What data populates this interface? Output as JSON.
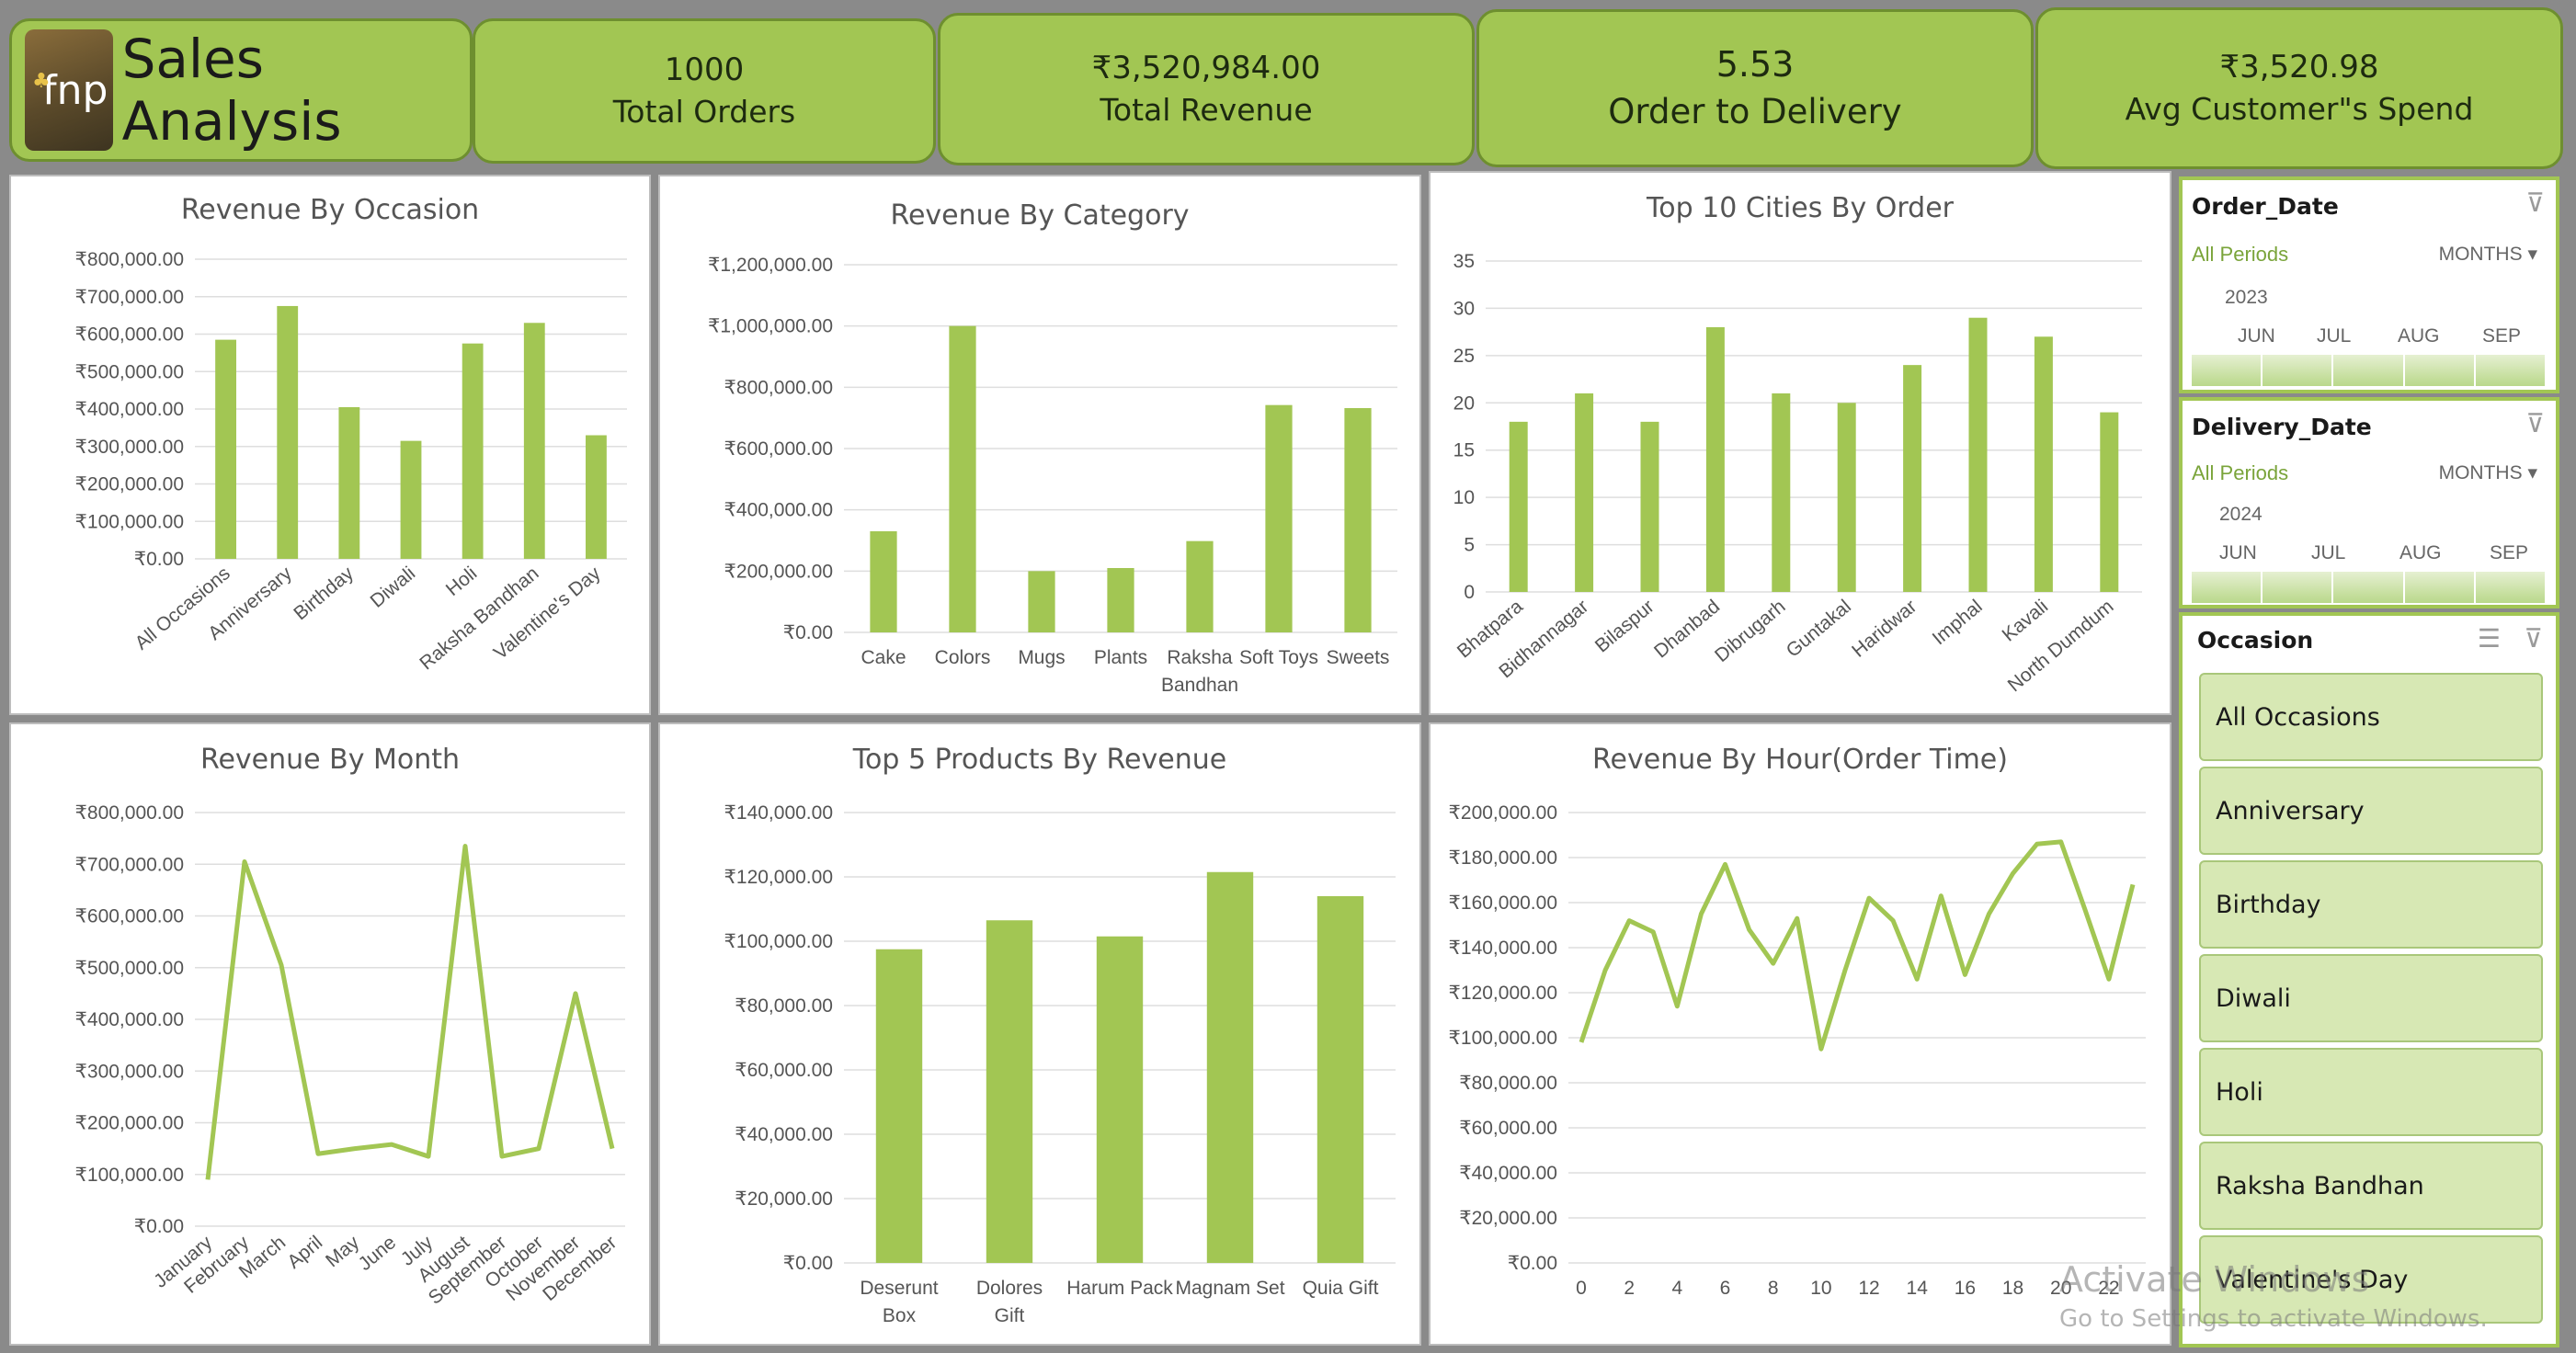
{
  "header": {
    "title": "Sales Analysis",
    "logo_text": "fnp",
    "kpis": [
      {
        "value": "1000",
        "label": "Total Orders"
      },
      {
        "value": "₹3,520,984.00",
        "label": "Total Revenue"
      },
      {
        "value": "5.53",
        "label": "Order to  Delivery"
      },
      {
        "value": "₹3,520.98",
        "label": "Avg Customer\"s Spend"
      }
    ]
  },
  "chart_data": [
    {
      "type": "bar",
      "title": "Revenue By Occasion",
      "categories": [
        "All Occasions",
        "Anniversary",
        "Birthday",
        "Diwali",
        "Holi",
        "Raksha Bandhan",
        "Valentine's Day"
      ],
      "values": [
        585000,
        675000,
        405000,
        315000,
        575000,
        630000,
        330000
      ],
      "ylim": [
        0,
        800000
      ],
      "yticks": [
        "₹0.00",
        "₹100,000.00",
        "₹200,000.00",
        "₹300,000.00",
        "₹400,000.00",
        "₹500,000.00",
        "₹600,000.00",
        "₹700,000.00",
        "₹800,000.00"
      ]
    },
    {
      "type": "bar",
      "title": "Revenue By Category",
      "categories": [
        "Cake",
        "Colors",
        "Mugs",
        "Plants",
        "Raksha Bandhan",
        "Soft Toys",
        "Sweets"
      ],
      "values": [
        330000,
        1000000,
        200000,
        210000,
        298000,
        742000,
        732000
      ],
      "ylim": [
        0,
        1200000
      ],
      "yticks": [
        "₹0.00",
        "₹200,000.00",
        "₹400,000.00",
        "₹600,000.00",
        "₹800,000.00",
        "₹1,000,000.00",
        "₹1,200,000.00"
      ]
    },
    {
      "type": "bar",
      "title": "Top 10 Cities By Order",
      "categories": [
        "Bhatpara",
        "Bidhannagar",
        "Bilaspur",
        "Dhanbad",
        "Dibrugarh",
        "Guntakal",
        "Haridwar",
        "Imphal",
        "Kavali",
        "North Dumdum"
      ],
      "values": [
        18,
        21,
        18,
        28,
        21,
        20,
        24,
        29,
        27,
        19
      ],
      "ylim": [
        0,
        35
      ],
      "yticks": [
        "0",
        "5",
        "10",
        "15",
        "20",
        "25",
        "30",
        "35"
      ]
    },
    {
      "type": "line",
      "title": "Revenue By Month",
      "categories": [
        "January",
        "February",
        "March",
        "April",
        "May",
        "June",
        "July",
        "August",
        "September",
        "October",
        "November",
        "December"
      ],
      "values": [
        90000,
        705000,
        505000,
        140000,
        150000,
        158000,
        135000,
        735000,
        135000,
        150000,
        450000,
        150000
      ],
      "ylim": [
        0,
        800000
      ],
      "yticks": [
        "₹0.00",
        "₹100,000.00",
        "₹200,000.00",
        "₹300,000.00",
        "₹400,000.00",
        "₹500,000.00",
        "₹600,000.00",
        "₹700,000.00",
        "₹800,000.00"
      ]
    },
    {
      "type": "bar",
      "title": "Top 5 Products By Revenue",
      "categories": [
        "Deserunt Box",
        "Dolores Gift",
        "Harum Pack",
        "Magnam Set",
        "Quia Gift"
      ],
      "values": [
        97500,
        106500,
        101500,
        121500,
        114000
      ],
      "ylim": [
        0,
        140000
      ],
      "yticks": [
        "₹0.00",
        "₹20,000.00",
        "₹40,000.00",
        "₹60,000.00",
        "₹80,000.00",
        "₹100,000.00",
        "₹120,000.00",
        "₹140,000.00"
      ]
    },
    {
      "type": "line",
      "title": "Revenue By Hour(Order Time)",
      "x": [
        0,
        1,
        2,
        3,
        4,
        5,
        6,
        7,
        8,
        9,
        10,
        11,
        12,
        13,
        14,
        15,
        16,
        17,
        18,
        19,
        20,
        21,
        22,
        23
      ],
      "values": [
        98000,
        130000,
        152000,
        147000,
        114000,
        155000,
        177000,
        148000,
        133000,
        153000,
        95000,
        130000,
        162000,
        152000,
        126000,
        163000,
        128000,
        155000,
        173000,
        186000,
        187000,
        157000,
        126000,
        168000
      ],
      "xticks": [
        "0",
        "2",
        "4",
        "6",
        "8",
        "10",
        "12",
        "14",
        "16",
        "18",
        "20",
        "22"
      ],
      "ylim": [
        0,
        200000
      ],
      "yticks": [
        "₹0.00",
        "₹20,000.00",
        "₹40,000.00",
        "₹60,000.00",
        "₹80,000.00",
        "₹100,000.00",
        "₹120,000.00",
        "₹140,000.00",
        "₹160,000.00",
        "₹180,000.00",
        "₹200,000.00"
      ]
    }
  ],
  "slicers": {
    "order_date": {
      "title": "Order_Date",
      "period": "All Periods",
      "unit": "MONTHS",
      "year": "2023",
      "months": [
        "JUN",
        "JUL",
        "AUG",
        "SEP"
      ]
    },
    "delivery_date": {
      "title": "Delivery_Date",
      "period": "All Periods",
      "unit": "MONTHS",
      "year": "2024",
      "months": [
        "JUN",
        "JUL",
        "AUG",
        "SEP"
      ]
    },
    "occasion": {
      "title": "Occasion",
      "items": [
        "All Occasions",
        "Anniversary",
        "Birthday",
        "Diwali",
        "Holi",
        "Raksha Bandhan",
        "Valentine's Day"
      ]
    }
  },
  "watermark": {
    "line1": "Activate Windows",
    "line2": "Go to Settings to activate Windows."
  },
  "colors": {
    "accent": "#a2c653",
    "accent_dark": "#6e8f2f",
    "slicer_button": "#d7e8b4"
  },
  "icons": [
    "fnp-logo",
    "multi-select-icon",
    "clear-filter-icon"
  ]
}
